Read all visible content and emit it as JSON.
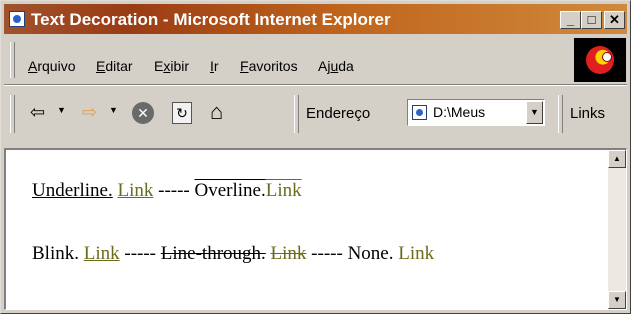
{
  "window": {
    "title": "Text Decoration - Microsoft Internet Explorer"
  },
  "caption_buttons": {
    "minimize": "_",
    "maximize": "□",
    "close": "✕"
  },
  "menu": {
    "items": [
      {
        "label": "Arquivo",
        "accesskey": "A",
        "rest": "rquivo"
      },
      {
        "label": "Editar",
        "accesskey": "E",
        "rest": "ditar"
      },
      {
        "label": "Exibir",
        "pre": "E",
        "accesskey": "x",
        "rest": "ibir"
      },
      {
        "label": "Ir",
        "accesskey": "I",
        "rest": "r"
      },
      {
        "label": "Favoritos",
        "accesskey": "F",
        "rest": "avoritos"
      },
      {
        "label": "Ajuda",
        "pre": "Aj",
        "accesskey": "u",
        "rest": "da"
      }
    ]
  },
  "toolbar": {
    "back_icon": "back-arrow-icon",
    "forward_icon": "forward-arrow-icon",
    "stop_icon": "stop-icon",
    "refresh_icon": "refresh-icon",
    "home_icon": "home-icon",
    "address_label": "Endereço",
    "address_value": "D:\\Meus",
    "links_label": "Links"
  },
  "content": {
    "line1": {
      "underline_text": "Underline.",
      "underline_link": "Link",
      "sep": "-----",
      "overline_text": "Overline.",
      "overline_link": "Link"
    },
    "line2": {
      "blink_text": "Blink.",
      "blink_link": "Link",
      "sep1": "-----",
      "linethrough_text": "Line-through.",
      "linethrough_link": "Link",
      "sep2": "-----",
      "none_text": "None.",
      "none_link": "Link"
    }
  },
  "colors": {
    "link": "#6b6b1c",
    "titlebar": "#a0522d",
    "chrome": "#d4d0c8"
  }
}
